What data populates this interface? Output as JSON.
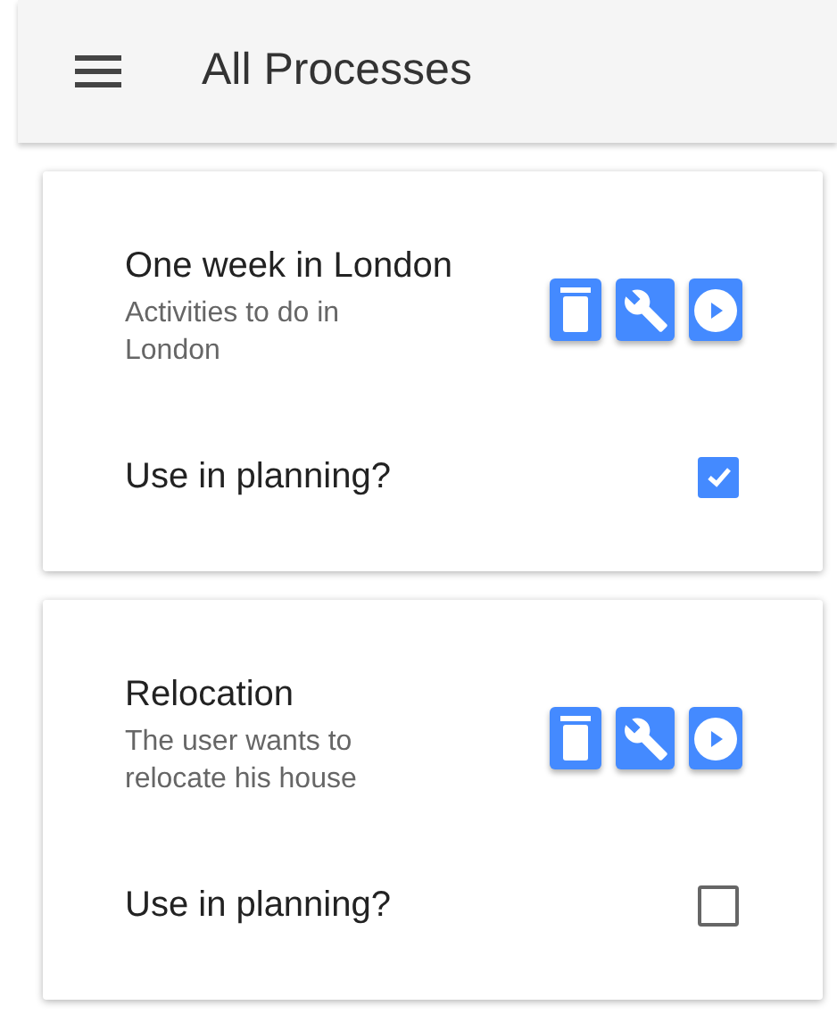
{
  "app_bar": {
    "title": "All Processes"
  },
  "processes": [
    {
      "title": "One week in London",
      "description": "Activities to do in London",
      "planning_label": "Use in planning?",
      "checked": true
    },
    {
      "title": "Relocation",
      "description": "The user wants to relocate his house",
      "planning_label": "Use in planning?",
      "checked": false
    }
  ]
}
